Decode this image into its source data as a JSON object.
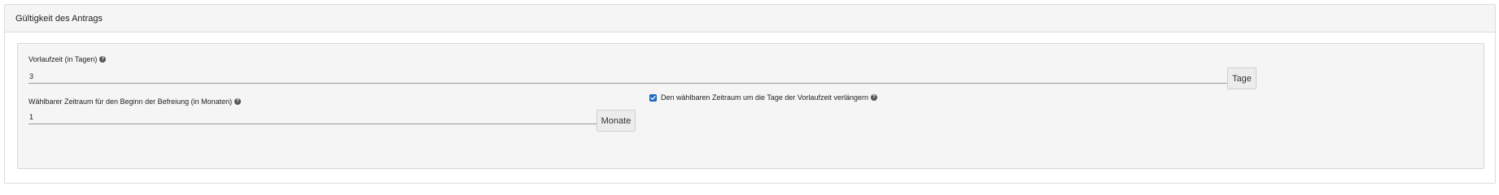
{
  "panel": {
    "title": "Gültigkeit des Antrags"
  },
  "vorlaufzeit": {
    "label": "Vorlaufzeit (in Tagen)",
    "value": "3",
    "unit": "Tage"
  },
  "zeitraum": {
    "label": "Wählbarer Zeitraum für den Beginn der Befreiung (in Monaten)",
    "value": "1",
    "unit": "Monate"
  },
  "verlaengern": {
    "label": "Den wählbaren Zeitraum um die Tage der Vorlaufzeit verlängern",
    "checked": true
  },
  "icons": {
    "help": "question-circle-icon",
    "check": "check-icon"
  },
  "colors": {
    "checkbox": "#1f6fcf"
  }
}
